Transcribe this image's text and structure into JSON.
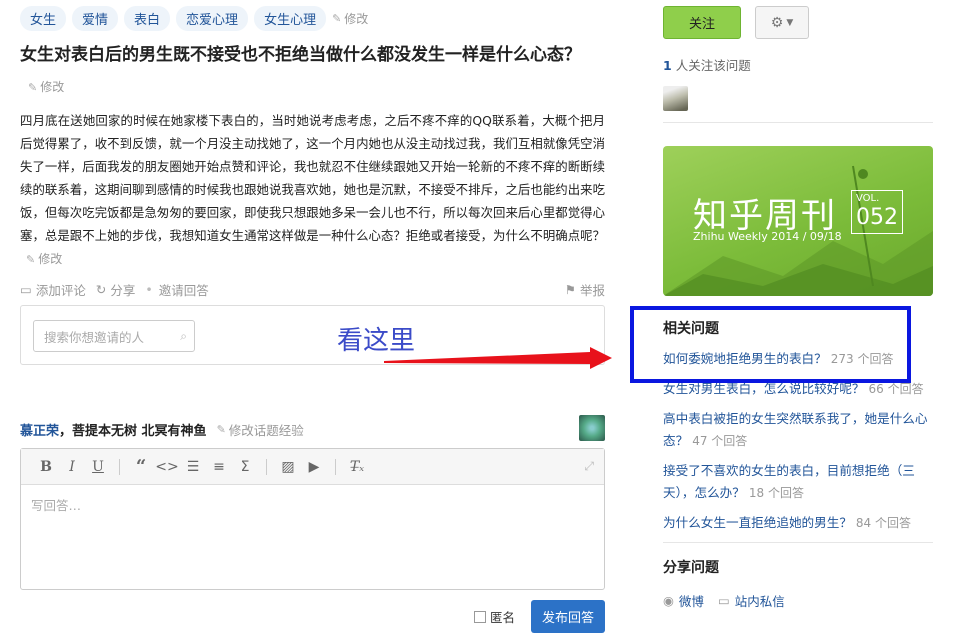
{
  "topics": [
    "女生",
    "爱情",
    "表白",
    "恋爱心理",
    "女生心理"
  ],
  "topics_edit": "修改",
  "question": {
    "title": "女生对表白后的男生既不接受也不拒绝当做什么都没发生一样是什么心态？",
    "title_edit": "修改",
    "detail": "四月底在送她回家的时候在她家楼下表白的，当时她说考虑考虑，之后不疼不痒的QQ联系着，大概个把月后觉得累了，收不到反馈，就一个月没主动找她了，这一个月内她也从没主动找过我，我们互相就像凭空消失了一样，后面我发的朋友圈她开始点赞和评论，我也就忍不住继续跟她又开始一轮新的不疼不痒的断断续续的联系着，这期间聊到感情的时候我也跟她说我喜欢她，她也是沉默，不接受不排斥，之后也能约出来吃饭，但每次吃完饭都是急匆匆的要回家，即使我只想跟她多呆一会儿也不行，所以每次回来后心里都觉得心塞，总是跟不上她的步伐，我想知道女生通常这样做是一种什么心态？拒绝或者接受，为什么不明确点呢？",
    "detail_edit": "修改"
  },
  "meta": {
    "add_comment": "添加评论",
    "share": "分享",
    "invite": "邀请回答",
    "report": "举报"
  },
  "invite": {
    "placeholder": "搜索你想邀请的人"
  },
  "annotation": {
    "text": "看这里"
  },
  "answerer": {
    "name": "慕正荣",
    "sign": "菩提本无树 北冥有神鱼",
    "edit_exp": "修改话题经验"
  },
  "editor": {
    "placeholder": "写回答…",
    "anonymous_label": "匿名",
    "submit_label": "发布回答"
  },
  "sidebar": {
    "follow_label": "关注",
    "follow_count": "1",
    "follow_text": "人关注该问题",
    "banner": {
      "title": "知乎周刊",
      "subtitle": "Zhihu Weekly 2014 / 09/18",
      "vol_label": "VOL.",
      "vol_num": "052"
    },
    "related_title": "相关问题",
    "related": [
      {
        "q": "如何委婉地拒绝男生的表白？",
        "count": "273 个回答"
      },
      {
        "q": "女生对男生表白，怎么说比较好呢？",
        "count": "66 个回答"
      },
      {
        "q": "高中表白被拒的女生突然联系我了，她是什么心态？",
        "count": "47 个回答"
      },
      {
        "q": "接受了不喜欢的女生的表白，目前想拒绝（三天），怎么办？",
        "count": "18 个回答"
      },
      {
        "q": "为什么女生一直拒绝追她的男生？",
        "count": "84 个回答"
      }
    ],
    "share_title": "分享问题",
    "share_weibo": "微博",
    "share_pm": "站内私信"
  },
  "colors": {
    "link": "#225599",
    "follow_green": "#8fcf4b",
    "submit_blue": "#2c72c7",
    "highlight_blue": "#0a17e0",
    "arrow_red": "#e8121b"
  }
}
